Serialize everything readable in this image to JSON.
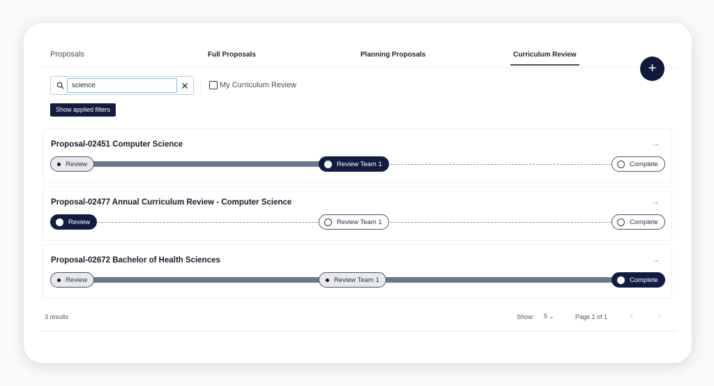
{
  "tabs": [
    {
      "label": "Proposals",
      "active": false
    },
    {
      "label": "Full Proposals",
      "active": false
    },
    {
      "label": "Planning Proposals",
      "active": false
    },
    {
      "label": "Curriculum Review",
      "active": true
    }
  ],
  "add_button": {
    "icon": "plus-icon",
    "label": "+"
  },
  "search": {
    "value": "science",
    "placeholder": "",
    "clear_icon": "close-icon",
    "clear_label": "✕"
  },
  "checkbox": {
    "label": "My Curriculum Review",
    "checked": false
  },
  "filters_button": {
    "label": "Show applied filters"
  },
  "proposals": [
    {
      "title": "Proposal-02451 Computer Science",
      "arrow": "→",
      "steps": [
        {
          "label": "Review",
          "state": "done"
        },
        {
          "label": "Review Team 1",
          "state": "current"
        },
        {
          "label": "Complete",
          "state": "todo"
        }
      ]
    },
    {
      "title": "Proposal-02477 Annual Curriculum Review - Computer Science",
      "arrow": "→",
      "steps": [
        {
          "label": "Review",
          "state": "current"
        },
        {
          "label": "Review Team 1",
          "state": "todo"
        },
        {
          "label": "Complete",
          "state": "todo"
        }
      ]
    },
    {
      "title": "Proposal-02672 Bachelor of Health Sciences",
      "arrow": "→",
      "steps": [
        {
          "label": "Review",
          "state": "done"
        },
        {
          "label": "Review Team 1",
          "state": "done"
        },
        {
          "label": "Complete",
          "state": "current"
        }
      ]
    }
  ],
  "footer": {
    "results": "3 results",
    "show_label": "Show:",
    "page_size": "5 ⌄",
    "page_info": "Page 1 of 1",
    "prev": "‹",
    "next": "›"
  },
  "colors": {
    "primary": "#121c40",
    "track": "#6d7890"
  }
}
